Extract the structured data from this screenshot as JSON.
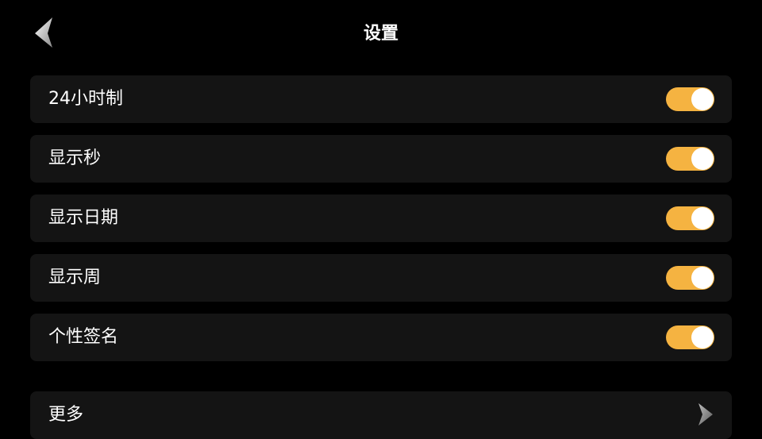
{
  "header": {
    "title": "设置",
    "back_icon": "chevron-left-icon"
  },
  "settings": [
    {
      "label": "24小时制",
      "enabled": true
    },
    {
      "label": "显示秒",
      "enabled": true
    },
    {
      "label": "显示日期",
      "enabled": true
    },
    {
      "label": "显示周",
      "enabled": true
    },
    {
      "label": "个性签名",
      "enabled": true
    }
  ],
  "more": {
    "label": "更多",
    "icon": "chevron-right-icon"
  },
  "colors": {
    "background": "#000000",
    "row": "#141414",
    "accent": "#f5b341",
    "text": "#ffffff"
  }
}
